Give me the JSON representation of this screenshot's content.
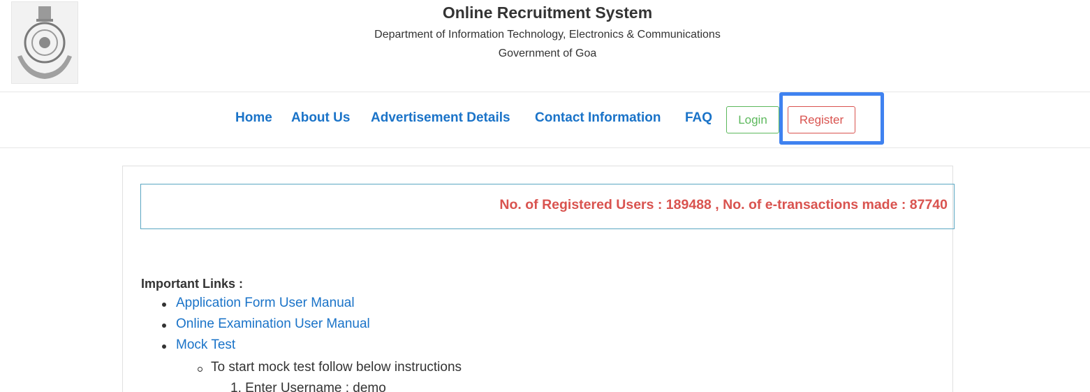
{
  "header": {
    "title": "Online Recruitment System",
    "subtitle_line1": "Department of Information Technology, Electronics & Communications",
    "subtitle_line2": "Government of Goa",
    "logo_icon": "government-of-goa-emblem"
  },
  "nav": {
    "items": [
      "Home",
      "About Us",
      "Advertisement Details",
      "Contact Information",
      "FAQ"
    ],
    "login_label": "Login",
    "register_label": "Register",
    "link_color": "#1a73c8",
    "login_color": "#5cb85c",
    "register_color": "#d9534f",
    "highlight_color": "#3f82f0"
  },
  "stats": {
    "text": "No. of Registered Users : 189488 , No. of e-transactions made : 87740"
  },
  "important_links": {
    "heading": "Important Links :",
    "items": [
      "Application Form User Manual",
      "Online Examination User Manual",
      "Mock Test"
    ],
    "mock_test_instruction": "To start mock test follow below instructions",
    "steps": [
      "1. Enter Username : demo"
    ]
  }
}
